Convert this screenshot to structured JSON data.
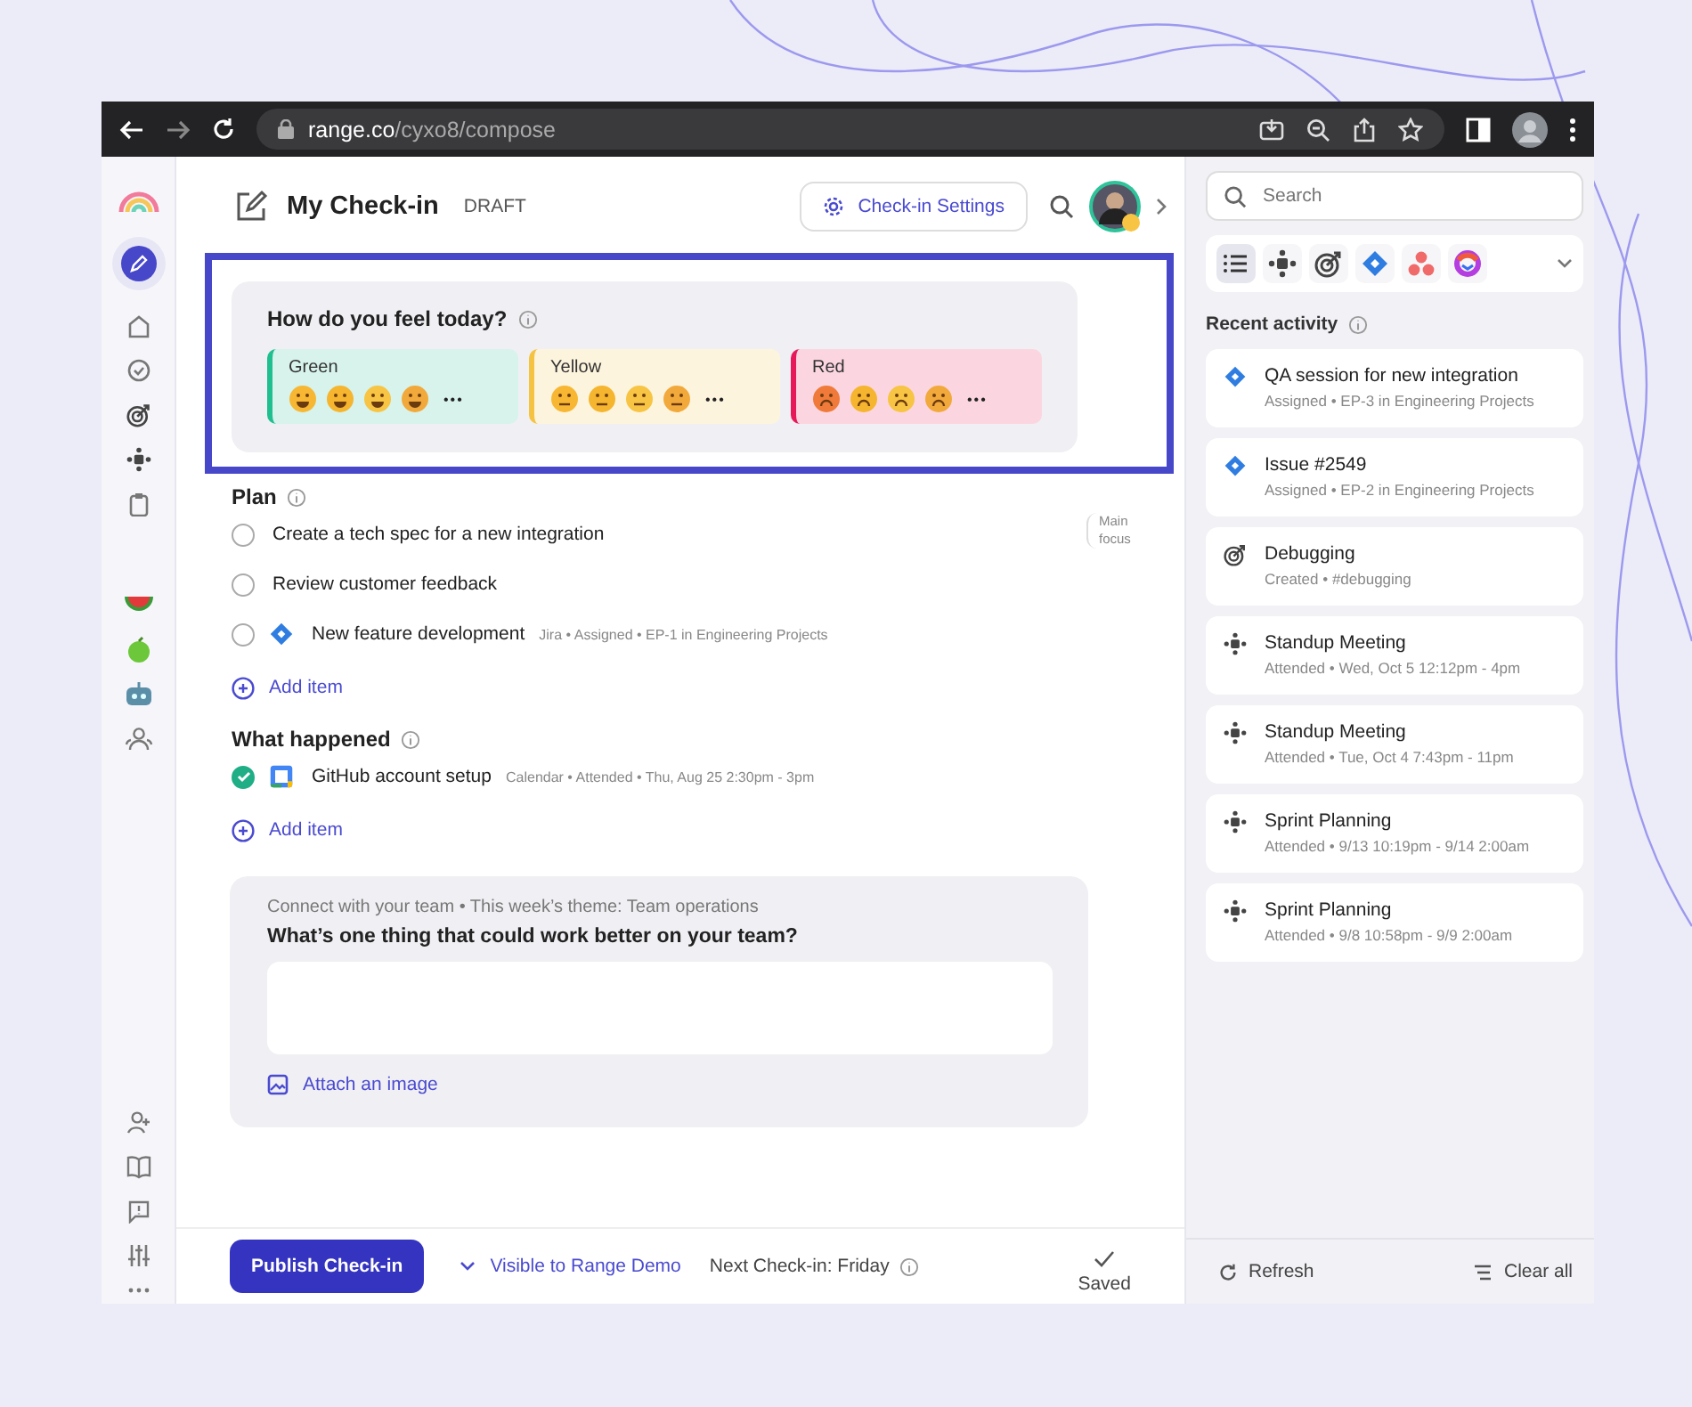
{
  "browser": {
    "url_host": "range.co",
    "url_path": "/cyxo8/compose"
  },
  "header": {
    "title": "My Check-in",
    "status": "DRAFT",
    "settings_button": "Check-in Settings"
  },
  "mood": {
    "question": "How do you feel today?",
    "options": [
      {
        "label": "Green",
        "color": "#1fbf8f",
        "more": "•••"
      },
      {
        "label": "Yellow",
        "color": "#f5c342",
        "more": "•••"
      },
      {
        "label": "Red",
        "color": "#e8195a",
        "more": "•••"
      }
    ]
  },
  "plan": {
    "title": "Plan",
    "main_focus": "Main focus",
    "items": [
      {
        "text": "Create a tech spec for a new integration",
        "checked": false
      },
      {
        "text": "Review customer feedback",
        "checked": false
      },
      {
        "text": "New feature development",
        "checked": false,
        "kind": "jira",
        "meta": "Jira • Assigned • EP-1 in Engineering Projects"
      }
    ],
    "add": "Add item"
  },
  "happened": {
    "title": "What happened",
    "items": [
      {
        "text": "GitHub account setup",
        "checked": true,
        "kind": "calendar",
        "meta": "Calendar • Attended • Thu, Aug 25 2:30pm - 3pm"
      }
    ],
    "add": "Add item"
  },
  "prompt": {
    "context": "Connect with your team • This week’s theme: Team operations",
    "question": "What’s one thing that could work better on your team?",
    "attach": "Attach an image"
  },
  "footer": {
    "publish": "Publish Check-in",
    "visibility": "Visible to Range Demo",
    "next": "Next Check-in: Friday",
    "saved": "Saved"
  },
  "side": {
    "search_placeholder": "Search",
    "filters": [
      {
        "kind": "list",
        "selected": true
      },
      {
        "kind": "meeting",
        "selected": false
      },
      {
        "kind": "goal",
        "selected": false
      },
      {
        "kind": "jira",
        "selected": false
      },
      {
        "kind": "asana",
        "selected": false
      },
      {
        "kind": "other",
        "selected": false
      }
    ],
    "title": "Recent activity",
    "activity": [
      {
        "kind": "jira",
        "title": "QA session for new integration",
        "detail": "Assigned • EP-3 in Engineering Projects"
      },
      {
        "kind": "jira",
        "title": "Issue #2549",
        "detail": "Assigned • EP-2 in Engineering Projects"
      },
      {
        "kind": "goal",
        "title": "Debugging",
        "detail": "Created • #debugging"
      },
      {
        "kind": "meeting",
        "title": "Standup Meeting",
        "detail": "Attended • Wed, Oct 5 12:12pm - 4pm"
      },
      {
        "kind": "meeting",
        "title": "Standup Meeting",
        "detail": "Attended • Tue, Oct 4 7:43pm - 11pm"
      },
      {
        "kind": "meeting",
        "title": "Sprint Planning",
        "detail": "Attended • 9/13 10:19pm - 9/14 2:00am"
      },
      {
        "kind": "meeting",
        "title": "Sprint Planning",
        "detail": "Attended • 9/8 10:58pm - 9/9 2:00am"
      }
    ],
    "refresh": "Refresh",
    "clear": "Clear all"
  }
}
